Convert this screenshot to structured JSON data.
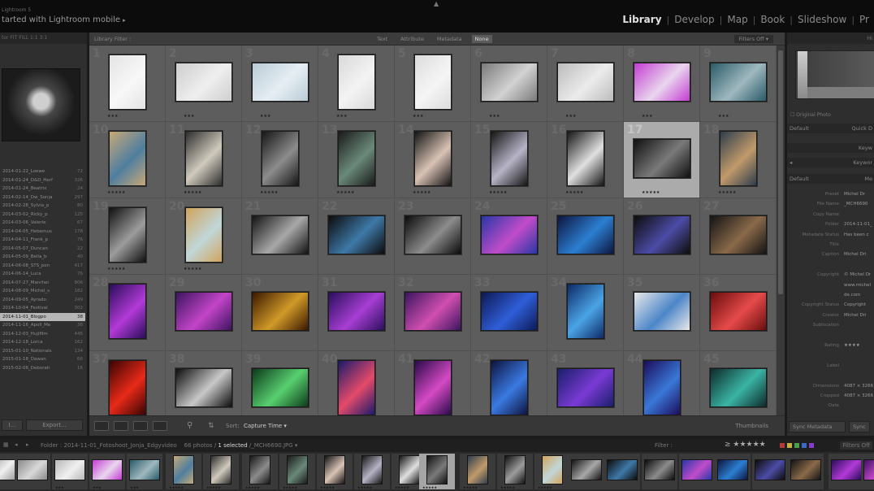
{
  "topbar": {
    "app_name": "Lightroom 5",
    "catalog_title": "tarted with Lightroom mobile",
    "catalog_caret": "▸",
    "modules": [
      {
        "label": "Library",
        "active": true
      },
      {
        "label": "Develop",
        "active": false
      },
      {
        "label": "Map",
        "active": false
      },
      {
        "label": "Book",
        "active": false
      },
      {
        "label": "Slideshow",
        "active": false
      },
      {
        "label": "Pr",
        "active": false
      }
    ]
  },
  "left_panel": {
    "navigator_header": "tor  FIT  FILL  1:1  3:1",
    "folders": [
      {
        "name": "2014-01-22_Loewe",
        "count": "72"
      },
      {
        "name": "2014-01-24_D&D_Herf",
        "count": "326"
      },
      {
        "name": "2014-01-24_Beatrix",
        "count": "24"
      },
      {
        "name": "2014-02-14_Dw_Sonja",
        "count": "297"
      },
      {
        "name": "2014-02-28_Sylvia_p",
        "count": "80"
      },
      {
        "name": "2014-03-02_Ricky_p",
        "count": "125"
      },
      {
        "name": "2014-03-06_Valerie",
        "count": "67"
      },
      {
        "name": "2014-04-05_Hebemus",
        "count": "178"
      },
      {
        "name": "2014-04-11_Frank_p",
        "count": "76"
      },
      {
        "name": "2014-05-07_Duncan",
        "count": "22"
      },
      {
        "name": "2014-05-09_Bella_b",
        "count": "40"
      },
      {
        "name": "2014-06-08_STS_pon",
        "count": "417"
      },
      {
        "name": "2014-06-14_Luca",
        "count": "76"
      },
      {
        "name": "2014-07-27_Manrhei",
        "count": "806"
      },
      {
        "name": "2014-08-09_Michel_s",
        "count": "182"
      },
      {
        "name": "2014-09-05_Ayrado",
        "count": "249"
      },
      {
        "name": "2014-10-04_Festival",
        "count": "302"
      },
      {
        "name": "2014-11-01_Blogpo",
        "count": "38"
      },
      {
        "name": "2014-11-16_Apoll_Me",
        "count": "38"
      },
      {
        "name": "2014-12-03_Hujifilm",
        "count": "445"
      },
      {
        "name": "2014-12-18_Lorca",
        "count": "162"
      },
      {
        "name": "2015-01-10_Nationals",
        "count": "134"
      },
      {
        "name": "2015-01-18_Dawan",
        "count": "66"
      },
      {
        "name": "2015-02-06_Deborah",
        "count": "16"
      }
    ],
    "selected_folder_index": 17,
    "import_label": "I...",
    "export_label": "Export..."
  },
  "center": {
    "filter_label": "Library Filter :",
    "filter_tabs": [
      {
        "label": "Text",
        "active": false
      },
      {
        "label": "Attribute",
        "active": false
      },
      {
        "label": "Metadata",
        "active": false
      },
      {
        "label": "None",
        "active": true
      }
    ],
    "filter_preset": "Filters Off ▾",
    "grid_cells": [
      {
        "n": "1",
        "stars": "★★★",
        "c1": "#e4e4e4",
        "c2": "#f8f8f8",
        "or": "p"
      },
      {
        "n": "2",
        "stars": "★★★",
        "c1": "#cfcfcf",
        "c2": "#eeeeee",
        "or": "l"
      },
      {
        "n": "3",
        "stars": "★★★",
        "c1": "#b9cbd6",
        "c2": "#e6eef3",
        "or": "l"
      },
      {
        "n": "4",
        "stars": "★★★",
        "c1": "#d9d9d9",
        "c2": "#f3f3f3",
        "or": "p"
      },
      {
        "n": "5",
        "stars": "★★★",
        "c1": "#dcdcdc",
        "c2": "#f5f5f5",
        "or": "p"
      },
      {
        "n": "6",
        "stars": "★★★",
        "c1": "#7a7a7a",
        "c2": "#d2d2d2",
        "or": "l"
      },
      {
        "n": "7",
        "stars": "★★★",
        "c1": "#bcbcbc",
        "c2": "#ebebeb",
        "or": "l"
      },
      {
        "n": "8",
        "stars": "★★★",
        "c1": "#c43cd2",
        "c2": "#e9d6ee",
        "or": "l"
      },
      {
        "n": "9",
        "stars": "★★★",
        "c1": "#2a5b68",
        "c2": "#9fb8bf",
        "or": "l"
      },
      {
        "n": "10",
        "stars": "★★★★★",
        "c1": "#c7a978",
        "c2": "#4f7e9f",
        "or": "p"
      },
      {
        "n": "11",
        "stars": "★★★★★",
        "c1": "#2d2d2d",
        "c2": "#d0cabd",
        "or": "p"
      },
      {
        "n": "12",
        "stars": "★★★★★",
        "c1": "#161616",
        "c2": "#8c8c8c",
        "or": "p"
      },
      {
        "n": "13",
        "stars": "★★★★★",
        "c1": "#1a1a1a",
        "c2": "#6a8a7a",
        "or": "p"
      },
      {
        "n": "14",
        "stars": "★★★★★",
        "c1": "#141414",
        "c2": "#d9c2b5",
        "or": "p"
      },
      {
        "n": "15",
        "stars": "★★★★★",
        "c1": "#151515",
        "c2": "#b6b3c6",
        "or": "p"
      },
      {
        "n": "16",
        "stars": "★★★★★",
        "c1": "#161616",
        "c2": "#e0e0e0",
        "or": "p"
      },
      {
        "n": "17",
        "stars": "★★★★★",
        "c1": "#111111",
        "c2": "#7a7a7a",
        "or": "l"
      },
      {
        "n": "18",
        "stars": "★★★★★",
        "c1": "#2e3d4c",
        "c2": "#c09a6a",
        "or": "p"
      },
      {
        "n": "19",
        "stars": "★★★★★",
        "c1": "#111111",
        "c2": "#9c9c9c",
        "or": "p"
      },
      {
        "n": "20",
        "stars": "★★★★★",
        "c1": "#d1a45c",
        "c2": "#c1d7d9",
        "or": "p"
      },
      {
        "n": "21",
        "stars": "",
        "c1": "#141414",
        "c2": "#a8a8a8",
        "or": "l"
      },
      {
        "n": "22",
        "stars": "",
        "c1": "#0c0c0c",
        "c2": "#3e79a8",
        "or": "l"
      },
      {
        "n": "23",
        "stars": "",
        "c1": "#0b0b0b",
        "c2": "#8c8c8c",
        "or": "l"
      },
      {
        "n": "24",
        "stars": "",
        "c1": "#2837a7",
        "c2": "#c14cc9",
        "or": "l"
      },
      {
        "n": "25",
        "stars": "",
        "c1": "#0d1640",
        "c2": "#2c7fd1",
        "or": "l"
      },
      {
        "n": "26",
        "stars": "",
        "c1": "#0d0d0d",
        "c2": "#4c4ca6",
        "or": "l"
      },
      {
        "n": "27",
        "stars": "",
        "c1": "#141414",
        "c2": "#8a6a4a",
        "or": "l"
      },
      {
        "n": "28",
        "stars": "",
        "c1": "#2a0d5a",
        "c2": "#b23ad8",
        "or": "p"
      },
      {
        "n": "29",
        "stars": "",
        "c1": "#3d1460",
        "c2": "#c245c8",
        "or": "l"
      },
      {
        "n": "30",
        "stars": "",
        "c1": "#3b1800",
        "c2": "#d09a28",
        "or": "l"
      },
      {
        "n": "31",
        "stars": "",
        "c1": "#2a0f5c",
        "c2": "#a73ed3",
        "or": "l"
      },
      {
        "n": "32",
        "stars": "",
        "c1": "#3c155f",
        "c2": "#d04fb0",
        "or": "l"
      },
      {
        "n": "33",
        "stars": "",
        "c1": "#0d1a55",
        "c2": "#2f5ed8",
        "or": "l"
      },
      {
        "n": "34",
        "stars": "",
        "c1": "#0d2a66",
        "c2": "#4aa4e6",
        "or": "p"
      },
      {
        "n": "35",
        "stars": "",
        "c1": "#e9e9e9",
        "c2": "#4c86c8",
        "or": "l"
      },
      {
        "n": "36",
        "stars": "",
        "c1": "#6a0d0d",
        "c2": "#e64a4a",
        "or": "l"
      },
      {
        "n": "37",
        "stars": "",
        "c1": "#3a0404",
        "c2": "#e82a18",
        "or": "p"
      },
      {
        "n": "38",
        "stars": "",
        "c1": "#0e0e0e",
        "c2": "#c8c8c8",
        "or": "l"
      },
      {
        "n": "39",
        "stars": "",
        "c1": "#0d3a1a",
        "c2": "#58d070",
        "or": "l"
      },
      {
        "n": "40",
        "stars": "",
        "c1": "#1a1a6a",
        "c2": "#e44a6a",
        "or": "p"
      },
      {
        "n": "41",
        "stars": "",
        "c1": "#2a0a4a",
        "c2": "#d44ac4",
        "or": "p"
      },
      {
        "n": "42",
        "stars": "",
        "c1": "#0d1440",
        "c2": "#3a7ae0",
        "or": "p"
      },
      {
        "n": "43",
        "stars": "",
        "c1": "#1a1f6a",
        "c2": "#7a3ad4",
        "or": "l"
      },
      {
        "n": "44",
        "stars": "",
        "c1": "#1a0d5a",
        "c2": "#3a78d8",
        "or": "p"
      },
      {
        "n": "45",
        "stars": "",
        "c1": "#0d2a2a",
        "c2": "#3ab4a4",
        "or": "l"
      }
    ],
    "selected_cell_index": 16,
    "sort_label": "Sort:",
    "sort_value": "Capture Time ▾",
    "thumbnails_label": "Thumbnails"
  },
  "right_panel": {
    "histogram_label": "Hi",
    "original_photo_label": "Original Photo",
    "default_label": "Default",
    "quick_develop_label": "Quick D",
    "keywording_label": "Keyw",
    "keyword_list_label": "Keywor",
    "metadata_header": "Default",
    "metadata_short": "Me",
    "metadata": [
      {
        "label": "Preset",
        "value": "Michel Dr"
      },
      {
        "label": "File Name",
        "value": "_MCH6690"
      },
      {
        "label": "Copy Name",
        "value": ""
      },
      {
        "label": "Folder",
        "value": "2014-11-01_"
      },
      {
        "label": "Metadata Status",
        "value": "Has been c"
      },
      {
        "label": "Title",
        "value": ""
      },
      {
        "label": "Caption",
        "value": "Michel Dri"
      },
      {
        "label": "",
        "value": ""
      },
      {
        "label": "Copyright",
        "value": "© Michel Dr"
      },
      {
        "label": "",
        "value": "www.michel"
      },
      {
        "label": "",
        "value": "de.com"
      },
      {
        "label": "Copyright Status",
        "value": "Copyright"
      },
      {
        "label": "Creator",
        "value": "Michel Dri"
      },
      {
        "label": "Sublocation",
        "value": ""
      },
      {
        "label": "",
        "value": ""
      },
      {
        "label": "Rating",
        "value": "★★★★"
      },
      {
        "label": "",
        "value": ""
      },
      {
        "label": "Label",
        "value": ""
      },
      {
        "label": "",
        "value": ""
      },
      {
        "label": "Dimensions",
        "value": "4087 × 3266"
      },
      {
        "label": "Cropped",
        "value": "4087 × 3266"
      },
      {
        "label": "Date",
        "value": ""
      }
    ],
    "sync_metadata_label": "Sync Metadata",
    "sync_settings_label": "Sync"
  },
  "filmbar": {
    "path_text": "Folder : 2014-11-01_Fotoshoot_Jonja_Edgyvideo",
    "photos_text": "66 photos /",
    "selected_text": "1 selected",
    "filename_text": "/_MCH6690.JPG ▾",
    "filter_label": "Filter :",
    "filter_stars": "≥ ★★★★★",
    "filters_off_label": "Filters Off"
  },
  "filmstrip": [
    {
      "c1": "#9a9a9a",
      "c2": "#f0f0f0",
      "stars": ""
    },
    {
      "c1": "#8a8a8a",
      "c2": "#d8d8d8",
      "stars": ""
    },
    {
      "c1": "#b8b8b8",
      "c2": "#f0f0f0",
      "stars": "★★★"
    },
    {
      "c1": "#c43cd2",
      "c2": "#e9d6ee",
      "stars": "★★★"
    },
    {
      "c1": "#2a5b68",
      "c2": "#9fb8bf",
      "stars": "★★★"
    },
    {
      "c1": "#c7a978",
      "c2": "#4f7e9f",
      "stars": "★★★★★"
    },
    {
      "c1": "#2d2d2d",
      "c2": "#d0cabd",
      "stars": "★★★★★"
    },
    {
      "c1": "#161616",
      "c2": "#8c8c8c",
      "stars": "★★★★★"
    },
    {
      "c1": "#1a1a1a",
      "c2": "#6a8a7a",
      "stars": "★★★★★"
    },
    {
      "c1": "#141414",
      "c2": "#d9c2b5",
      "stars": "★★★★★"
    },
    {
      "c1": "#151515",
      "c2": "#b6b3c6",
      "stars": "★★★★★"
    },
    {
      "c1": "#161616",
      "c2": "#e0e0e0",
      "stars": "★★★★★"
    },
    {
      "c1": "#111111",
      "c2": "#7a7a7a",
      "stars": "★★★★★"
    },
    {
      "c1": "#2e3d4c",
      "c2": "#c09a6a",
      "stars": "★★★★★"
    },
    {
      "c1": "#111111",
      "c2": "#9c9c9c",
      "stars": "★★★★★"
    },
    {
      "c1": "#d1a45c",
      "c2": "#c1d7d9",
      "stars": "★★★★★"
    },
    {
      "c1": "#141414",
      "c2": "#a8a8a8",
      "stars": ""
    },
    {
      "c1": "#0c0c0c",
      "c2": "#3e79a8",
      "stars": ""
    },
    {
      "c1": "#0b0b0b",
      "c2": "#8c8c8c",
      "stars": ""
    },
    {
      "c1": "#2837a7",
      "c2": "#c14cc9",
      "stars": ""
    },
    {
      "c1": "#0d1640",
      "c2": "#2c7fd1",
      "stars": ""
    },
    {
      "c1": "#0d0d0d",
      "c2": "#4c4ca6",
      "stars": ""
    },
    {
      "c1": "#141414",
      "c2": "#8a6a4a",
      "stars": ""
    },
    {
      "c1": "#2a0d5a",
      "c2": "#b23ad8",
      "stars": ""
    },
    {
      "c1": "#3d1460",
      "c2": "#c245c8",
      "stars": ""
    }
  ],
  "filmstrip_selected_index": 12,
  "colors": {
    "accent_text": "#e2e2e2",
    "panel_bg": "#2f2f2f",
    "grid_bg": "#4b4b4b",
    "cell_bg": "#5d5d5d",
    "cell_selected": "#ababab"
  }
}
